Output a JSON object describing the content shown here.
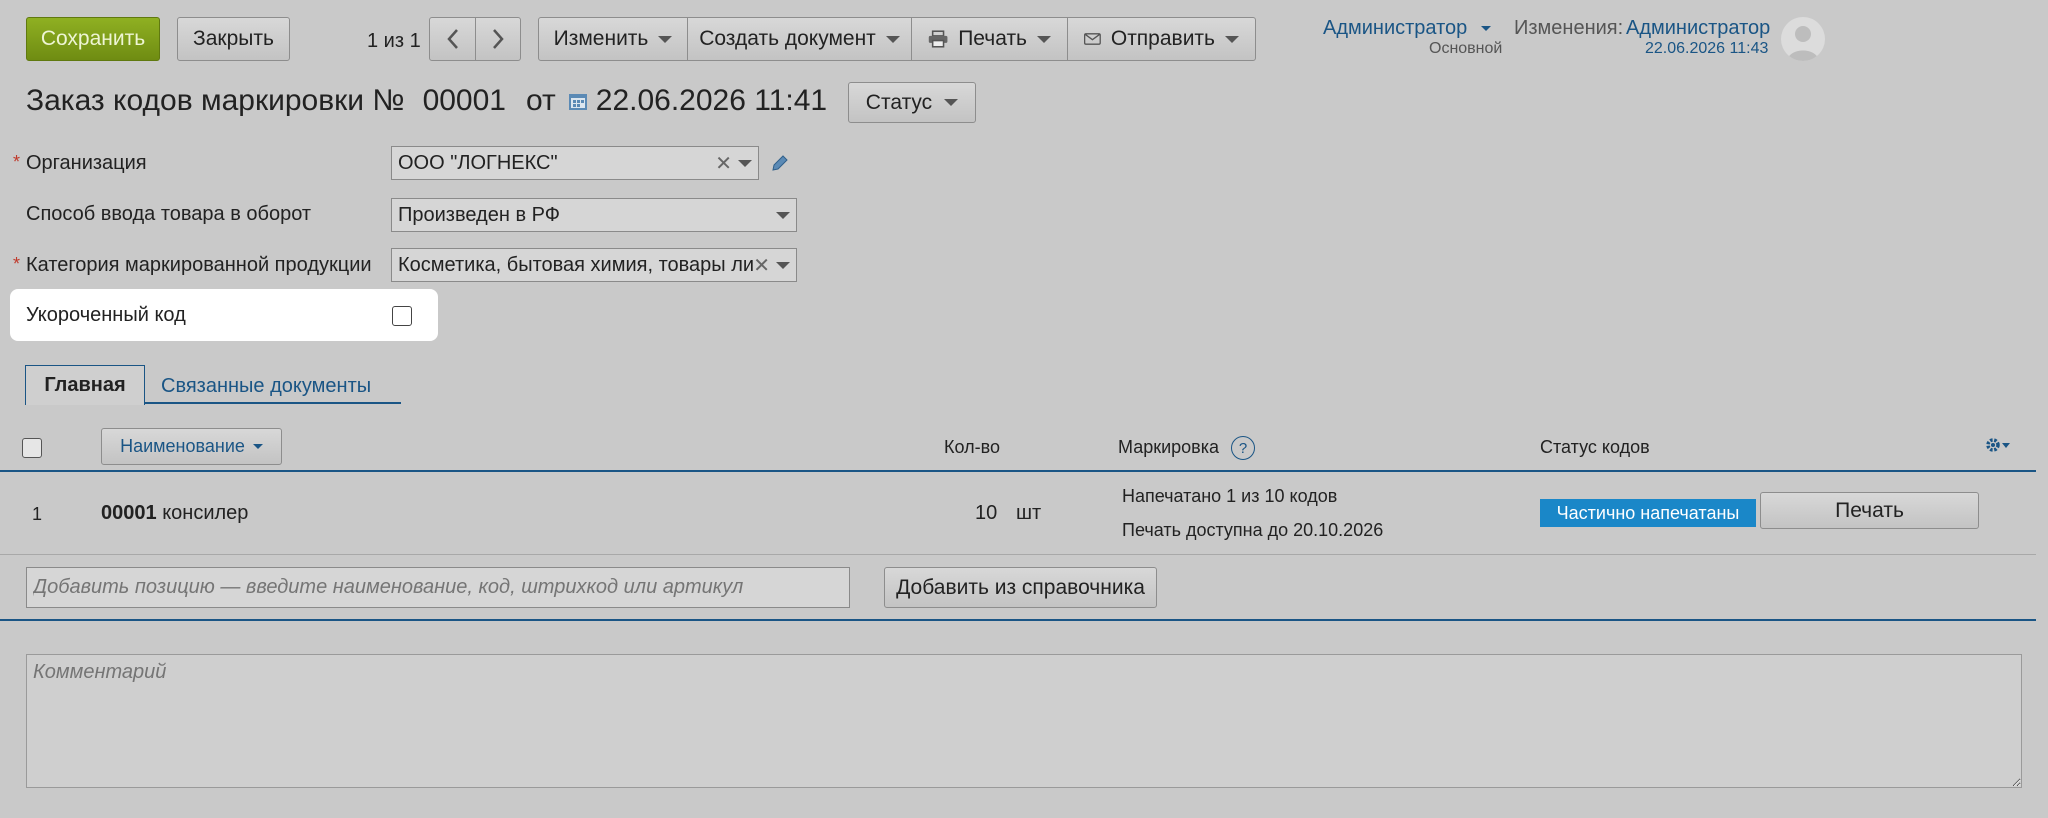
{
  "toolbar": {
    "save_label": "Сохранить",
    "close_label": "Закрыть",
    "counter": "1 из 1",
    "change_label": "Изменить",
    "create_doc_label": "Создать документ",
    "print_label": "Печать",
    "send_label": "Отправить"
  },
  "user": {
    "name": "Администратор",
    "role": "Основной",
    "changes_label": "Изменения:",
    "changes_user": "Администратор",
    "changes_time": "22.06.2026 11:43"
  },
  "header": {
    "title": "Заказ кодов маркировки №",
    "number": "00001",
    "from_label": "от",
    "date": "22.06.2026 11:41",
    "status_label": "Статус"
  },
  "form": {
    "org_label": "Организация",
    "org_value": "ООО \"ЛОГНЕКС\"",
    "entry_label": "Способ ввода товара в оборот",
    "entry_value": "Произведен в РФ",
    "category_label": "Категория маркированной продукции",
    "category_value": "Косметика, бытовая химия, товары личной гигиены",
    "short_code_label": "Укороченный код",
    "short_code_checked": false
  },
  "tabs": [
    {
      "label": "Главная",
      "active": true
    },
    {
      "label": "Связанные документы",
      "active": false
    }
  ],
  "table": {
    "col_name": "Наименование",
    "col_qty": "Кол-во",
    "col_marking": "Маркировка",
    "col_marking_help": "?",
    "col_status": "Статус кодов",
    "rows": [
      {
        "index": "1",
        "code": "00001",
        "name": "консилер",
        "qty": "10",
        "unit": "шт",
        "marking_line1": "Напечатано 1 из 10 кодов",
        "marking_line2": "Печать доступна до 20.10.2026",
        "status_badge": "Частично напечатаны",
        "print_label": "Печать"
      }
    ]
  },
  "add_row": {
    "placeholder": "Добавить позицию — введите наименование, код, штрихкод или артикул",
    "from_catalog_label": "Добавить из справочника"
  },
  "comment": {
    "placeholder": "Комментарий"
  },
  "colors": {
    "accent": "#1a5585",
    "badge": "#1a87c8",
    "save": "#7f9e1a"
  }
}
